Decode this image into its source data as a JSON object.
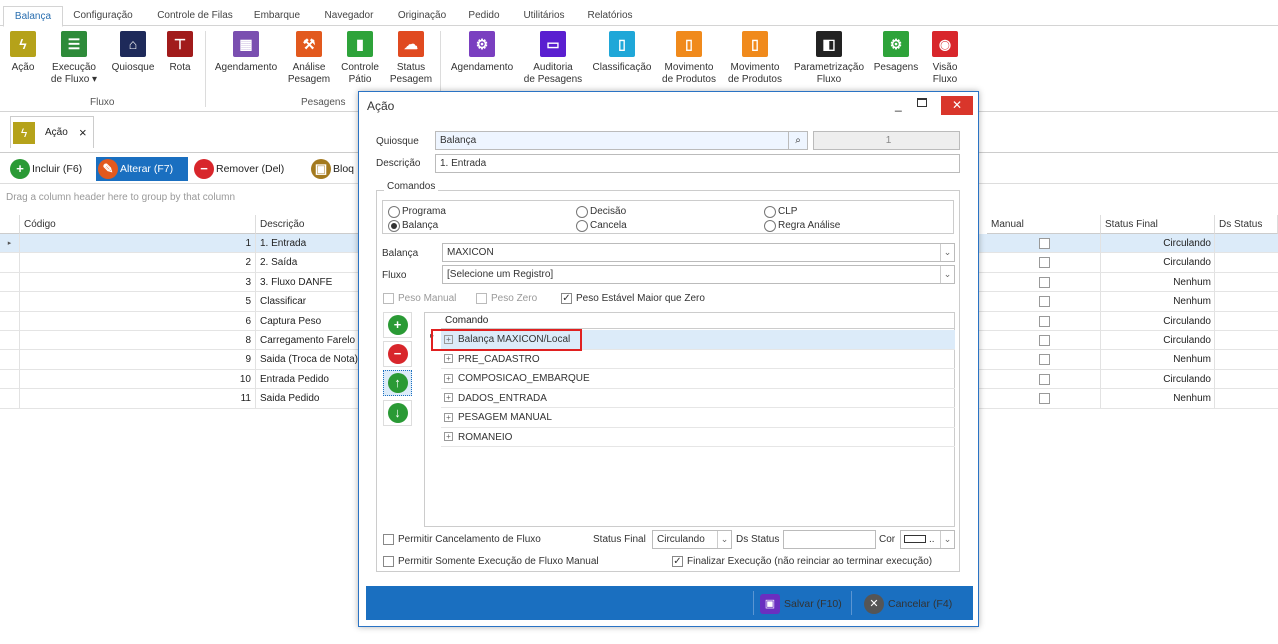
{
  "ribbon_tabs": [
    "Balança",
    "Configuração",
    "Controle de Filas",
    "Embarque",
    "Navegador",
    "Originação",
    "Pedido",
    "Utilitários",
    "Relatórios"
  ],
  "ribbon_buttons": {
    "acao": [
      "Ação",
      ""
    ],
    "execucao": [
      "Execução",
      "de Fluxo ▾"
    ],
    "quiosque": [
      "Quiosque",
      ""
    ],
    "rota": [
      "Rota",
      ""
    ],
    "agendamento1": [
      "Agendamento",
      ""
    ],
    "analise": [
      "Análise",
      "Pesagem"
    ],
    "controle": [
      "Controle",
      "Pátio"
    ],
    "status": [
      "Status",
      "Pesagem"
    ],
    "agendamento2": [
      "Agendamento",
      ""
    ],
    "auditoria": [
      "Auditoria",
      "de Pesagens"
    ],
    "classificacao": [
      "Classificação",
      ""
    ],
    "movimento1": [
      "Movimento",
      "de Produtos"
    ],
    "movimento2": [
      "Movimento",
      "de Produtos"
    ],
    "parametrizacao": [
      "Parametrização",
      "Fluxo"
    ],
    "pesagens": [
      "Pesagens",
      ""
    ],
    "visao": [
      "Visão",
      "Fluxo"
    ]
  },
  "ribbon_groups": {
    "fluxo": "Fluxo",
    "pesagens": "Pesagens"
  },
  "doc_tab": {
    "label": "Ação",
    "close": "×",
    "icon": "ϟ"
  },
  "toolbar": {
    "incluir": "Incluir (F6)",
    "alterar": "Alterar (F7)",
    "remover": "Remover (Del)",
    "bloq": "Bloq"
  },
  "grid": {
    "group_hint": "Drag a column header here to group by that column",
    "headers": {
      "codigo": "Código",
      "descricao": "Descrição",
      "manual": "Manual",
      "status_final": "Status Final",
      "ds_status": "Ds Status"
    },
    "rows": [
      {
        "codigo": "1",
        "descricao": "1. Entrada",
        "status": "Circulando"
      },
      {
        "codigo": "2",
        "descricao": "2. Saída",
        "status": "Circulando"
      },
      {
        "codigo": "3",
        "descricao": "3. Fluxo DANFE",
        "status": "Nenhum"
      },
      {
        "codigo": "5",
        "descricao": "Classificar",
        "status": "Nenhum"
      },
      {
        "codigo": "6",
        "descricao": "Captura Peso",
        "status": "Circulando"
      },
      {
        "codigo": "8",
        "descricao": "Carregamento Farelo",
        "status": "Circulando"
      },
      {
        "codigo": "9",
        "descricao": "Saida (Troca de Nota)",
        "status": "Nenhum"
      },
      {
        "codigo": "10",
        "descricao": "Entrada Pedido",
        "status": "Circulando"
      },
      {
        "codigo": "11",
        "descricao": "Saida Pedido",
        "status": "Nenhum"
      }
    ]
  },
  "dialog": {
    "title": "Ação",
    "quiosque_label": "Quiosque",
    "quiosque_value": "Balança",
    "quiosque_code": "1",
    "descricao_label": "Descrição",
    "descricao_value": "1. Entrada",
    "comandos_label": "Comandos",
    "radios": {
      "programa": "Programa",
      "balanca": "Balança",
      "decisao": "Decisão",
      "cancela": "Cancela",
      "clp": "CLP",
      "regra": "Regra Análise"
    },
    "balanca_label": "Balança",
    "balanca_value": "MAXICON",
    "fluxo_label": "Fluxo",
    "fluxo_value": "[Selecione um Registro]",
    "peso_manual": "Peso Manual",
    "peso_zero": "Peso Zero",
    "peso_estavel": "Peso Estável Maior que Zero",
    "comando_header": "Comando",
    "comandos": [
      "Balança MAXICON/Local",
      "PRE_CADASTRO",
      "COMPOSICAO_EMBARQUE",
      "DADOS_ENTRADA",
      "PESAGEM MANUAL",
      "ROMANEIO"
    ],
    "permitir_cancelamento": "Permitir Cancelamento de Fluxo",
    "status_final_label": "Status Final",
    "status_final_value": "Circulando",
    "ds_status_label": "Ds Status",
    "cor_label": "Cor",
    "cor_dots": "..",
    "permitir_somente": "Permitir Somente Execução de Fluxo Manual",
    "finalizar": "Finalizar Execução (não reinciar ao terminar execução)",
    "salvar": "Salvar (F10)",
    "cancelar": "Cancelar (F4)"
  },
  "colors": {
    "accent": "#1a6fc0",
    "highlight": "#e02020"
  }
}
